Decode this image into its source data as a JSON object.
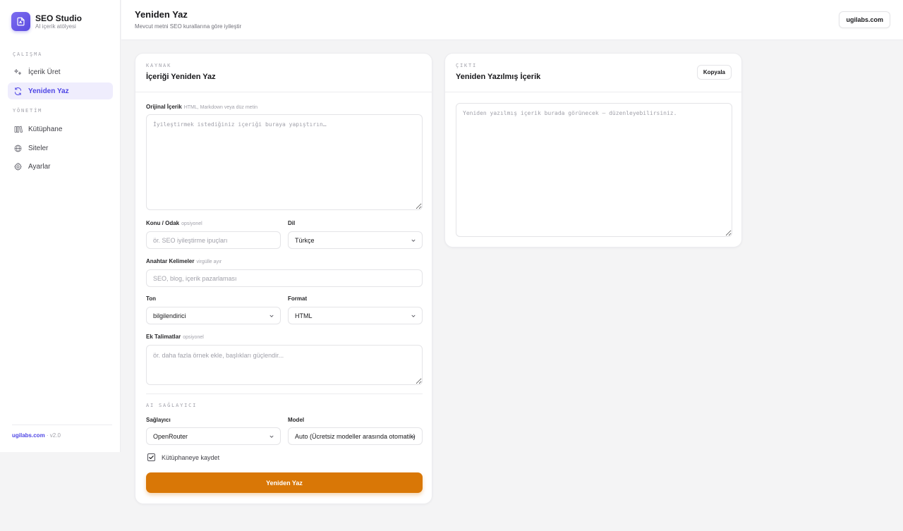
{
  "brand": {
    "name": "SEO Studio",
    "subtitle": "AI içerik atölyesi"
  },
  "sidebar": {
    "sections": [
      "ÇALIŞMA",
      "YÖNETİM"
    ],
    "items": [
      {
        "label": "İçerik Üret",
        "icon": "sparkles-icon",
        "active": false
      },
      {
        "label": "Yeniden Yaz",
        "icon": "refresh-icon",
        "active": true
      },
      {
        "label": "Kütüphane",
        "icon": "library-icon",
        "active": false
      },
      {
        "label": "Siteler",
        "icon": "globe-icon",
        "active": false
      },
      {
        "label": "Ayarlar",
        "icon": "gear-icon",
        "active": false
      }
    ],
    "footer": {
      "link": "ugilabs.com",
      "version": " · v2.0"
    }
  },
  "header": {
    "title": "Yeniden Yaz",
    "subtitle": "Mevcut metni SEO kurallarına göre iyileştir",
    "domain": "ugilabs.com"
  },
  "source": {
    "eyebrow": "KAYNAK",
    "title": "İçeriği Yeniden Yaz",
    "original": {
      "label": "Orijinal İçerik",
      "hint": "HTML, Markdown veya düz metin",
      "placeholder": "İyileştirmek istediğiniz içeriği buraya yapıştırın…",
      "value": ""
    },
    "topic": {
      "label": "Konu / Odak",
      "hint": "opsiyonel",
      "placeholder": "ör. SEO iyileştirme ipuçları",
      "value": ""
    },
    "language": {
      "label": "Dil",
      "value": "Türkçe"
    },
    "keywords": {
      "label": "Anahtar Kelimeler",
      "hint": "virgülle ayır",
      "placeholder": "SEO, blog, içerik pazarlaması",
      "value": ""
    },
    "tone": {
      "label": "Ton",
      "value": "bilgilendirici"
    },
    "format": {
      "label": "Format",
      "value": "HTML"
    },
    "instructions": {
      "label": "Ek Talimatlar",
      "hint": "opsiyonel",
      "placeholder": "ör. daha fazla örnek ekle, başlıkları güçlendir...",
      "value": ""
    },
    "ai_section": "AI SAĞLAYICI",
    "provider": {
      "label": "Sağlayıcı",
      "value": "OpenRouter"
    },
    "model": {
      "label": "Model",
      "value": "Auto (Ücretsiz modeller arasında otomatik)"
    },
    "save_to_library": {
      "label": "Kütüphaneye kaydet",
      "checked": true
    },
    "submit_label": "Yeniden Yaz"
  },
  "output": {
    "eyebrow": "ÇIKTI",
    "title": "Yeniden Yazılmış İçerik",
    "copy_label": "Kopyala",
    "placeholder": "Yeniden yazılmış içerik burada görünecek — düzenleyebilirsiniz.",
    "value": ""
  },
  "colors": {
    "accent": "#4f46e5",
    "primary_button": "#d97706",
    "brand_logo": "#6a5ae8"
  }
}
